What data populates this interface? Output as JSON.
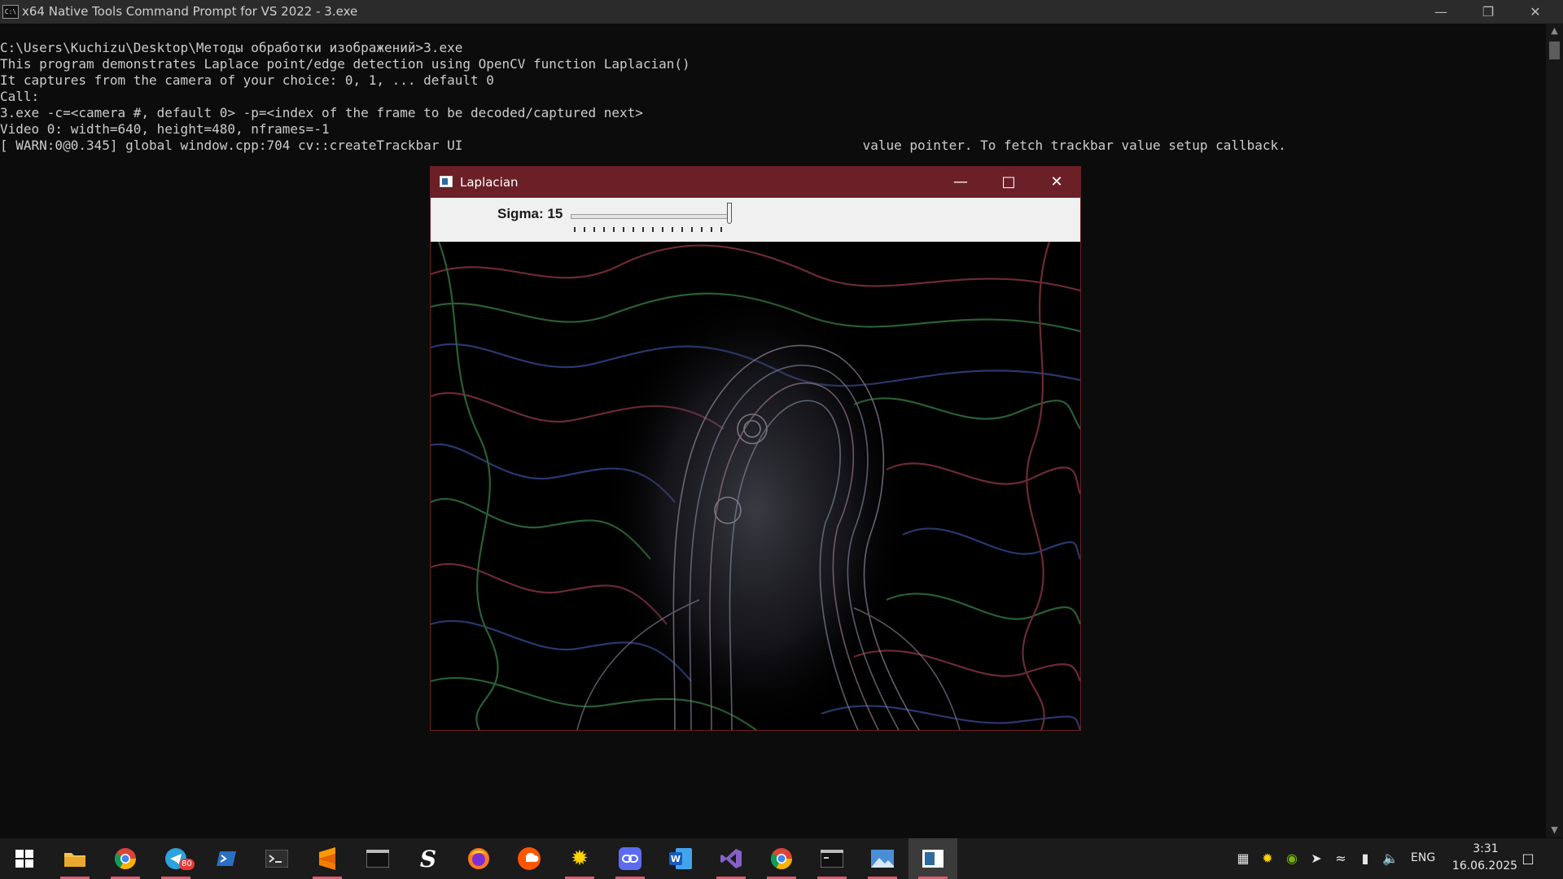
{
  "console": {
    "title": "x64 Native Tools Command Prompt for VS 2022 - 3.exe",
    "icon": "cmd-icon",
    "lines": [
      "C:\\Users\\Kuchizu\\Desktop\\Методы обработки изображений>3.exe",
      "",
      "This program demonstrates Laplace point/edge detection using OpenCV function Laplacian()",
      "It captures from the camera of your choice: 0, 1, ... default 0",
      "Call:",
      "3.exe -c=<camera #, default 0> -p=<index of the frame to be decoded/captured next>",
      "",
      "Video 0: width=640, height=480, nframes=-1",
      "[ WARN:0@0.345] global window.cpp:704 cv::createTrackbar UI                                                   value pointer. To fetch trackbar value setup callback."
    ]
  },
  "laplacian_window": {
    "title": "Laplacian",
    "trackbar": {
      "label": "Sigma: 15",
      "value": 15,
      "position_fraction": 1.0
    },
    "title_color": "#6b1f27"
  },
  "taskbar": {
    "apps": [
      {
        "name": "start-button",
        "icon": "windows-logo-icon"
      },
      {
        "name": "file-explorer",
        "icon": "folder-icon"
      },
      {
        "name": "chrome",
        "icon": "chrome-icon"
      },
      {
        "name": "telegram",
        "icon": "telegram-icon",
        "badge": "80"
      },
      {
        "name": "powershell",
        "icon": "powershell-icon"
      },
      {
        "name": "terminal",
        "icon": "terminal-icon"
      },
      {
        "name": "sublime-text",
        "icon": "sublime-icon"
      },
      {
        "name": "console",
        "icon": "console-icon"
      },
      {
        "name": "app-s",
        "icon": "s-app-icon"
      },
      {
        "name": "firefox",
        "icon": "firefox-icon"
      },
      {
        "name": "soundcloud",
        "icon": "soundcloud-icon"
      },
      {
        "name": "star-app",
        "icon": "sun-icon"
      },
      {
        "name": "link-app",
        "icon": "link-icon"
      },
      {
        "name": "word",
        "icon": "word-icon"
      },
      {
        "name": "visual-studio",
        "icon": "visual-studio-icon"
      },
      {
        "name": "chrome-canary",
        "icon": "chrome-icon"
      },
      {
        "name": "cmd",
        "icon": "cmd-icon"
      },
      {
        "name": "photos",
        "icon": "photo-icon"
      },
      {
        "name": "laplacian-app",
        "icon": "opencv-window-icon"
      }
    ],
    "lang": "ENG",
    "time": "3:31",
    "date": "16.06.2025",
    "accent": "#e05a70"
  }
}
